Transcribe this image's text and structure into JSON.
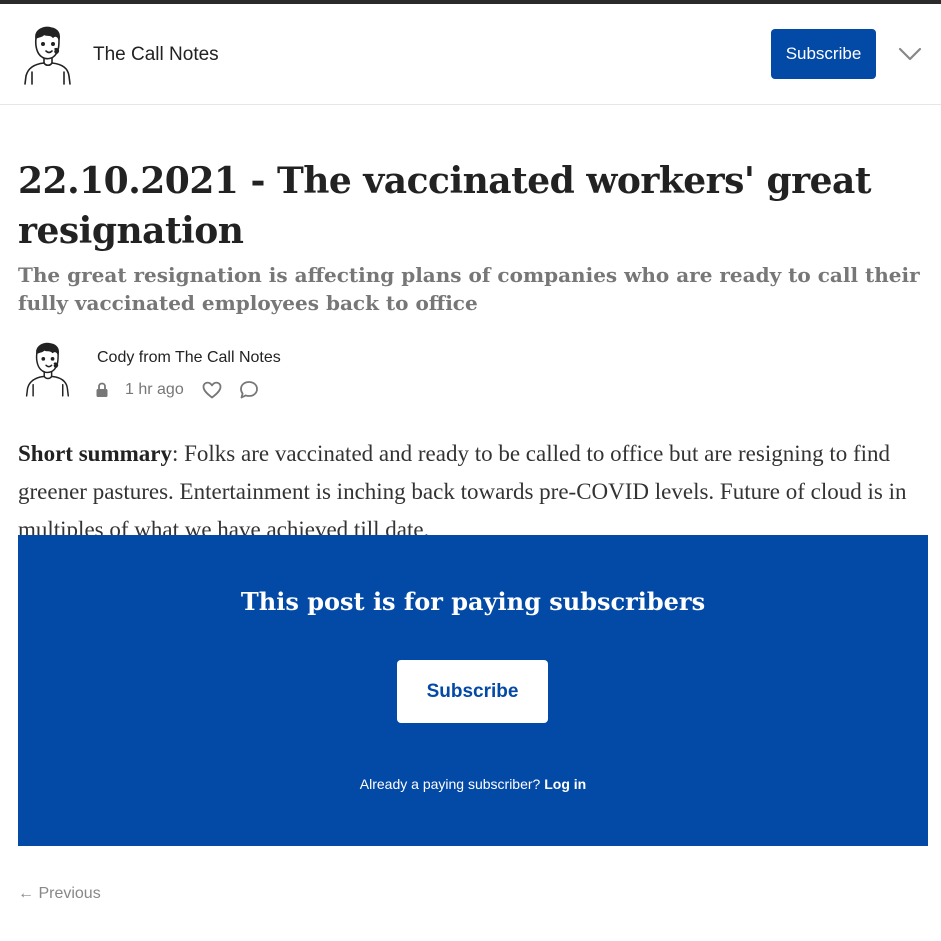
{
  "header": {
    "publication_name": "The Call Notes",
    "subscribe_label": "Subscribe",
    "menu_icon": "chevron-down-icon"
  },
  "post": {
    "title": "22.10.2021 - The vaccinated workers' great resignation",
    "subtitle": "The great resignation is affecting plans of companies who are ready to call their fully vaccinated employees back to office",
    "author": "Cody from The Call Notes",
    "time_ago": "1 hr ago",
    "icons": [
      "lock-icon",
      "heart-icon",
      "comment-icon"
    ],
    "summary_label": "Short summary",
    "summary_text": ": Folks are vaccinated and ready to be called to office but are resigning to find greener pastures. Entertainment is inching back towards pre-COVID levels. Future of cloud is in multiples of what we have achieved till date."
  },
  "paywall": {
    "title": "This post is for paying subscribers",
    "subscribe_label": "Subscribe",
    "already_text": "Already a paying subscriber? ",
    "login_label": "Log in"
  },
  "navigation": {
    "previous_label": "← Previous"
  },
  "colors": {
    "brand_blue": "#0349a6",
    "text": "#222222",
    "muted": "#777777"
  }
}
